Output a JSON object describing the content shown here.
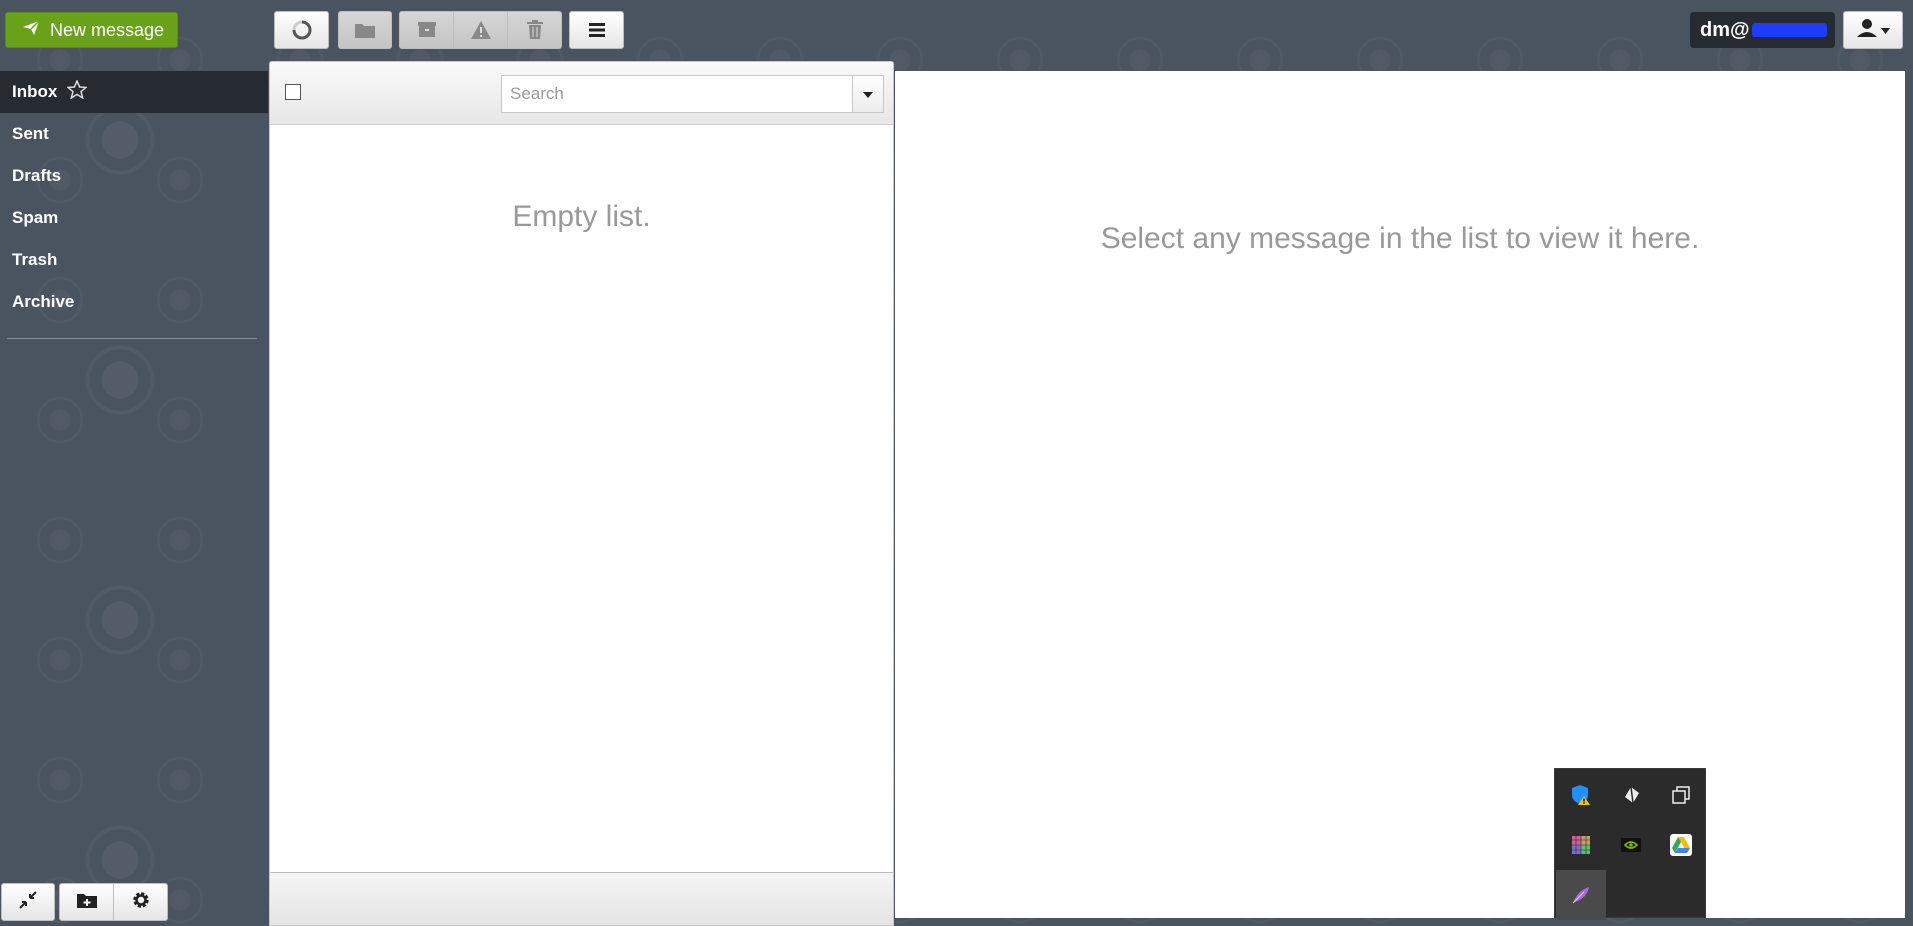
{
  "toolbar": {
    "new_message_label": "New message"
  },
  "user": {
    "email_visible": "dm@"
  },
  "sidebar": {
    "folders": [
      {
        "label": "Inbox"
      },
      {
        "label": "Sent"
      },
      {
        "label": "Drafts"
      },
      {
        "label": "Spam"
      },
      {
        "label": "Trash"
      },
      {
        "label": "Archive"
      }
    ]
  },
  "list": {
    "search_placeholder": "Search",
    "empty_text": "Empty list."
  },
  "preview": {
    "empty_text": "Select any message in the list to view it here."
  },
  "tray_icons": [
    "windows-security-warning-icon",
    "app-diamond-icon",
    "duplicate-windows-icon",
    "color-grid-app-icon",
    "nvidia-icon",
    "google-drive-icon",
    "feather-app-icon"
  ],
  "colors": {
    "accent_green": "#6aa31a",
    "background": "#4a5360",
    "active_folder": "#262a31"
  }
}
